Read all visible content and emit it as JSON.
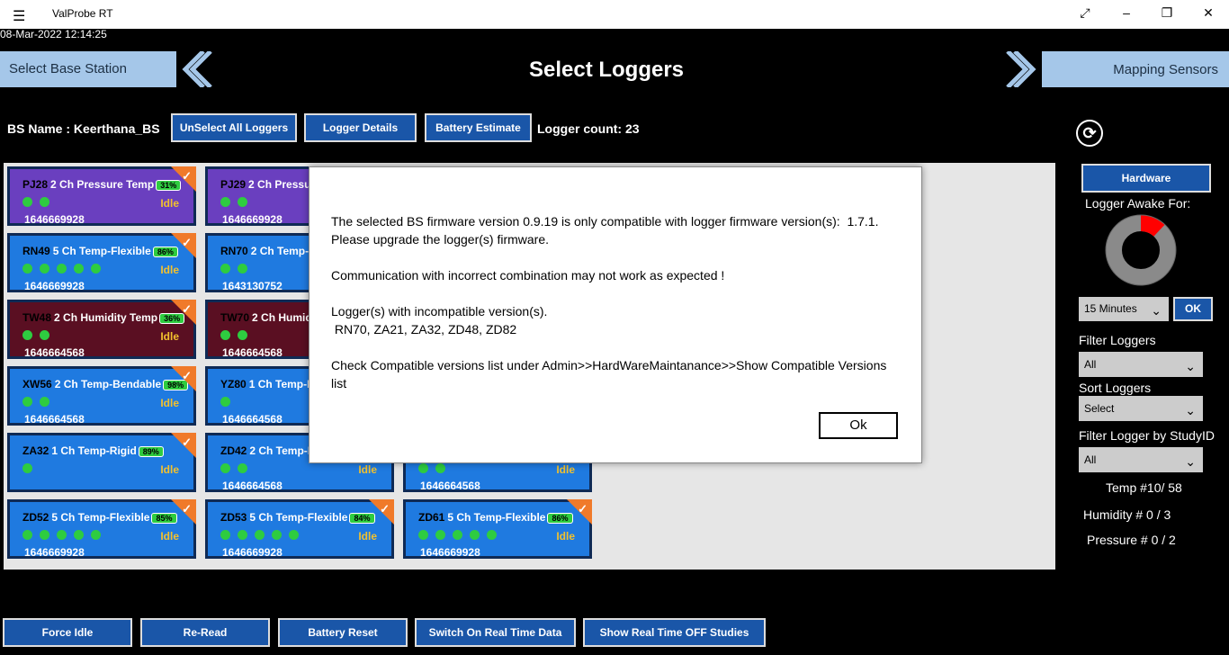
{
  "window": {
    "title": "ValProbe RT",
    "menu_icon": "☰",
    "maximize_icon": "⤢",
    "minimize_icon": "–",
    "restore_icon": "❐",
    "close_icon": "✕"
  },
  "datetime": "08-Mar-2022 12:14:25",
  "nav": {
    "left_label": "Select Base Station",
    "right_label": "Mapping Sensors",
    "page_title": "Select Loggers"
  },
  "bs": {
    "name_label": "BS Name :  Keerthana_BS",
    "unselect_all": "UnSelect All Loggers",
    "logger_details": "Logger Details",
    "battery_estimate": "Battery Estimate",
    "logger_count": "Logger count: 23"
  },
  "loggers": [
    {
      "id": "PJ28",
      "desc": "2 Ch Pressure Temp",
      "batt": "31%",
      "status": "Idle",
      "ts": "1646669928",
      "dots": 2,
      "color": "#6a3fbf"
    },
    {
      "id": "PJ29",
      "desc": "2 Ch Pressure",
      "batt": "",
      "status": "",
      "ts": "1646669928",
      "dots": 2,
      "color": "#6a3fbf"
    },
    {
      "id": "RN49",
      "desc": "5 Ch Temp-Flexible",
      "batt": "86%",
      "status": "Idle",
      "ts": "1646669928",
      "dots": 5,
      "color": "#1f7ae0"
    },
    {
      "id": "RN70",
      "desc": "2 Ch Temp-I",
      "batt": "",
      "status": "",
      "ts": "1643130752",
      "dots": 2,
      "color": "#1f7ae0"
    },
    {
      "id": "TW48",
      "desc": "2 Ch Humidity Temp",
      "batt": "36%",
      "status": "Idle",
      "ts": "1646664568",
      "dots": 2,
      "color": "#5a0f22"
    },
    {
      "id": "TW70",
      "desc": "2 Ch Humidi",
      "batt": "",
      "status": "",
      "ts": "1646664568",
      "dots": 2,
      "color": "#5a0f22"
    },
    {
      "id": "XW56",
      "desc": "2 Ch Temp-Bendable",
      "batt": "98%",
      "status": "Idle",
      "ts": "1646664568",
      "dots": 2,
      "color": "#1f7ae0"
    },
    {
      "id": "YZ80",
      "desc": "1 Ch Temp-R",
      "batt": "",
      "status": "",
      "ts": "1646664568",
      "dots": 1,
      "color": "#1f7ae0"
    },
    {
      "id": "ZA32",
      "desc": "1 Ch Temp-Rigid",
      "batt": "89%",
      "status": "Idle",
      "ts": "",
      "dots": 1,
      "color": "#1f7ae0"
    },
    {
      "id": "ZD42",
      "desc": "2 Ch Temp-F",
      "batt": "",
      "status": "Idle",
      "ts": "1646664568",
      "dots": 2,
      "color": "#1f7ae0"
    },
    {
      "id": "",
      "desc": "",
      "batt": "",
      "status": "Idle",
      "ts": "1646664568",
      "dots": 2,
      "color": "#1f7ae0"
    },
    {
      "id": "ZD52",
      "desc": "5 Ch Temp-Flexible",
      "batt": "85%",
      "status": "Idle",
      "ts": "1646669928",
      "dots": 5,
      "color": "#1f7ae0"
    },
    {
      "id": "ZD53",
      "desc": "5 Ch Temp-Flexible",
      "batt": "84%",
      "status": "Idle",
      "ts": "1646669928",
      "dots": 5,
      "color": "#1f7ae0"
    },
    {
      "id": "ZD61",
      "desc": "5 Ch Temp-Flexible",
      "batt": "86%",
      "status": "Idle",
      "ts": "1646669928",
      "dots": 5,
      "color": "#1f7ae0"
    }
  ],
  "dialog": {
    "para1": "The selected BS firmware version 0.9.19 is only compatible with logger firmware version(s):  1.7.1.\nPlease upgrade the logger(s) firmware.",
    "para2": "Communication with incorrect combination may not work as expected !",
    "para3": "Logger(s) with incompatible version(s).\n RN70, ZA21, ZA32, ZD48, ZD82",
    "para4": "Check Compatible versions list under Admin>>HardWareMaintanance>>Show Compatible Versions list",
    "ok": "Ok"
  },
  "side": {
    "hardware": "Hardware",
    "logger_awake": "Logger Awake For:",
    "awake_fraction": 0.12,
    "awake_select": "15 Minutes",
    "ok": "OK",
    "filter_loggers": "Filter Loggers",
    "filter_value": "All",
    "sort_loggers": "Sort Loggers",
    "sort_value": "Select",
    "filter_study": "Filter Logger by StudyID",
    "study_value": "All",
    "temp": "Temp  #10/ 58",
    "humidity": "Humidity  # 0 / 3",
    "pressure": "Pressure  # 0 / 2",
    "colors": {
      "accent": "#1a56a8",
      "awake": "#ff0000"
    }
  },
  "bottom": {
    "force_idle": "Force Idle",
    "re_read": "Re-Read",
    "battery_reset": "Battery Reset",
    "realtime_on": "Switch On Real Time Data",
    "realtime_off": "Show Real Time OFF Studies"
  }
}
